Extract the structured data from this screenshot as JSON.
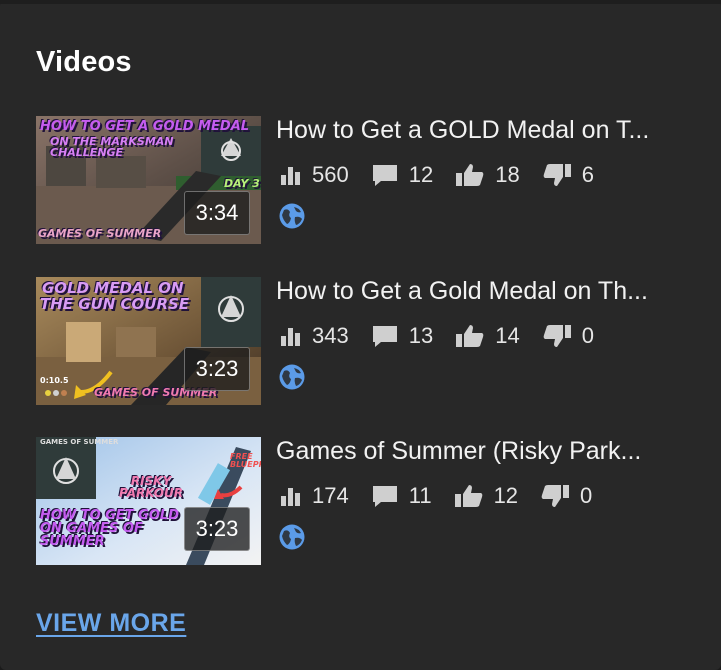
{
  "section": {
    "title": "Videos"
  },
  "videos": [
    {
      "title": "How to Get a GOLD Medal on T...",
      "duration": "3:34",
      "views": "560",
      "comments": "12",
      "likes": "18",
      "dislikes": "6",
      "thumb_text_1": "HOW TO GET A GOLD MEDAL",
      "thumb_text_2": "ON THE MARKSMAN CHALLENGE",
      "thumb_text_3": "GAMES OF SUMMER",
      "thumb_text_4": "DAY 3"
    },
    {
      "title": "How to Get a Gold Medal on Th...",
      "duration": "3:23",
      "views": "343",
      "comments": "13",
      "likes": "14",
      "dislikes": "0",
      "thumb_text_1": "GOLD MEDAL ON",
      "thumb_text_2": "THE GUN COURSE",
      "thumb_text_3": "GAMES OF SUMMER",
      "thumb_text_4": "0:10.5"
    },
    {
      "title": "Games of Summer (Risky Park...",
      "duration": "3:23",
      "views": "174",
      "comments": "11",
      "likes": "12",
      "dislikes": "0",
      "thumb_text_1": "RISKY PARKOUR",
      "thumb_text_2": "HOW TO GET GOLD ON GAMES OF SUMMER",
      "thumb_text_3": "FREE BLUEPRINT",
      "thumb_text_4": "GAMES OF SUMMER"
    }
  ],
  "footer": {
    "view_more_label": "VIEW MORE"
  },
  "colors": {
    "background": "#282828",
    "text": "#f2f2f2",
    "link": "#6aa6ea",
    "globe": "#5b9be8",
    "stat_icon": "#cfcfcf"
  },
  "icons": {
    "views": "bar-chart-icon",
    "comments": "comment-icon",
    "likes": "thumbs-up-icon",
    "dislikes": "thumbs-down-icon",
    "visibility": "globe-icon"
  }
}
